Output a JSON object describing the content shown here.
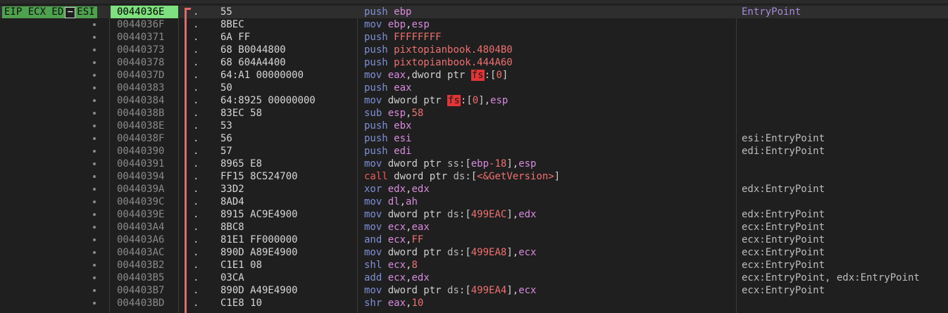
{
  "registers_label": {
    "prefix": "EIP ECX ED",
    "boxed": "−",
    "suffix": "ESI"
  },
  "rows": [
    {
      "addr": "0044036E",
      "marker": ".",
      "bytes": "55",
      "mnemonic": "push",
      "operands": [
        {
          "t": "ebp",
          "k": "reg"
        }
      ],
      "comment": "EntryPoint",
      "selected": true
    },
    {
      "addr": "0044036F",
      "marker": ".",
      "bytes": "8BEC",
      "mnemonic": "mov",
      "operands": [
        {
          "t": "ebp",
          "k": "reg"
        },
        {
          "t": ",",
          "k": "op"
        },
        {
          "t": "esp",
          "k": "reg"
        }
      ],
      "comment": ""
    },
    {
      "addr": "00440371",
      "marker": ".",
      "bytes": "6A FF",
      "mnemonic": "push",
      "operands": [
        {
          "t": "FFFFFFFF",
          "k": "num"
        }
      ],
      "comment": ""
    },
    {
      "addr": "00440373",
      "marker": ".",
      "bytes": "68 B0044800",
      "mnemonic": "push",
      "operands": [
        {
          "t": "pixtopianbook.4804B0",
          "k": "sym"
        }
      ],
      "comment": ""
    },
    {
      "addr": "00440378",
      "marker": ".",
      "bytes": "68 604A4400",
      "mnemonic": "push",
      "operands": [
        {
          "t": "pixtopianbook.444A60",
          "k": "sym"
        }
      ],
      "comment": ""
    },
    {
      "addr": "0044037D",
      "marker": ".",
      "bytes": "64:A1 00000000",
      "mnemonic": "mov",
      "operands": [
        {
          "t": "eax",
          "k": "reg"
        },
        {
          "t": ",dword ptr ",
          "k": "op"
        },
        {
          "t": "fs",
          "k": "segfs"
        },
        {
          "t": ":[",
          "k": "op"
        },
        {
          "t": "0",
          "k": "num"
        },
        {
          "t": "]",
          "k": "op"
        }
      ],
      "comment": ""
    },
    {
      "addr": "00440383",
      "marker": ".",
      "bytes": "50",
      "mnemonic": "push",
      "operands": [
        {
          "t": "eax",
          "k": "reg"
        }
      ],
      "comment": ""
    },
    {
      "addr": "00440384",
      "marker": ".",
      "bytes": "64:8925 00000000",
      "mnemonic": "mov",
      "operands": [
        {
          "t": "dword ptr ",
          "k": "op"
        },
        {
          "t": "fs",
          "k": "segfs"
        },
        {
          "t": ":[",
          "k": "op"
        },
        {
          "t": "0",
          "k": "num"
        },
        {
          "t": "],",
          "k": "op"
        },
        {
          "t": "esp",
          "k": "reg"
        }
      ],
      "comment": ""
    },
    {
      "addr": "0044038B",
      "marker": ".",
      "bytes": "83EC 58",
      "mnemonic": "sub",
      "operands": [
        {
          "t": "esp",
          "k": "reg"
        },
        {
          "t": ",",
          "k": "op"
        },
        {
          "t": "58",
          "k": "num"
        }
      ],
      "comment": ""
    },
    {
      "addr": "0044038E",
      "marker": ".",
      "bytes": "53",
      "mnemonic": "push",
      "operands": [
        {
          "t": "ebx",
          "k": "reg"
        }
      ],
      "comment": ""
    },
    {
      "addr": "0044038F",
      "marker": ".",
      "bytes": "56",
      "mnemonic": "push",
      "operands": [
        {
          "t": "esi",
          "k": "reg"
        }
      ],
      "comment": "esi:EntryPoint"
    },
    {
      "addr": "00440390",
      "marker": ".",
      "bytes": "57",
      "mnemonic": "push",
      "operands": [
        {
          "t": "edi",
          "k": "reg"
        }
      ],
      "comment": "edi:EntryPoint"
    },
    {
      "addr": "00440391",
      "marker": ".",
      "bytes": "8965 E8",
      "mnemonic": "mov",
      "operands": [
        {
          "t": "dword ptr ",
          "k": "op"
        },
        {
          "t": "ss",
          "k": "seg"
        },
        {
          "t": ":[",
          "k": "op"
        },
        {
          "t": "ebp",
          "k": "reg"
        },
        {
          "t": "-18",
          "k": "num"
        },
        {
          "t": "],",
          "k": "op"
        },
        {
          "t": "esp",
          "k": "reg"
        }
      ],
      "comment": ""
    },
    {
      "addr": "00440394",
      "marker": ".",
      "bytes": "FF15 8C524700",
      "mnemonic": "call",
      "mnemonic_kind": "call",
      "operands": [
        {
          "t": "dword ptr ",
          "k": "op"
        },
        {
          "t": "ds",
          "k": "seg"
        },
        {
          "t": ":[",
          "k": "op"
        },
        {
          "t": "<&GetVersion>",
          "k": "sym"
        },
        {
          "t": "]",
          "k": "op"
        }
      ],
      "comment": ""
    },
    {
      "addr": "0044039A",
      "marker": ".",
      "bytes": "33D2",
      "mnemonic": "xor",
      "operands": [
        {
          "t": "edx",
          "k": "reg"
        },
        {
          "t": ",",
          "k": "op"
        },
        {
          "t": "edx",
          "k": "reg"
        }
      ],
      "comment": "edx:EntryPoint"
    },
    {
      "addr": "0044039C",
      "marker": ".",
      "bytes": "8AD4",
      "mnemonic": "mov",
      "operands": [
        {
          "t": "dl",
          "k": "reg"
        },
        {
          "t": ",",
          "k": "op"
        },
        {
          "t": "ah",
          "k": "reg"
        }
      ],
      "comment": ""
    },
    {
      "addr": "0044039E",
      "marker": ".",
      "bytes": "8915 AC9E4900",
      "mnemonic": "mov",
      "operands": [
        {
          "t": "dword ptr ",
          "k": "op"
        },
        {
          "t": "ds",
          "k": "seg"
        },
        {
          "t": ":[",
          "k": "op"
        },
        {
          "t": "499EAC",
          "k": "num"
        },
        {
          "t": "],",
          "k": "op"
        },
        {
          "t": "edx",
          "k": "reg"
        }
      ],
      "comment": "edx:EntryPoint"
    },
    {
      "addr": "004403A4",
      "marker": ".",
      "bytes": "8BC8",
      "mnemonic": "mov",
      "operands": [
        {
          "t": "ecx",
          "k": "reg"
        },
        {
          "t": ",",
          "k": "op"
        },
        {
          "t": "eax",
          "k": "reg"
        }
      ],
      "comment": "ecx:EntryPoint"
    },
    {
      "addr": "004403A6",
      "marker": ".",
      "bytes": "81E1 FF000000",
      "mnemonic": "and",
      "operands": [
        {
          "t": "ecx",
          "k": "reg"
        },
        {
          "t": ",",
          "k": "op"
        },
        {
          "t": "FF",
          "k": "num"
        }
      ],
      "comment": "ecx:EntryPoint"
    },
    {
      "addr": "004403AC",
      "marker": ".",
      "bytes": "890D A89E4900",
      "mnemonic": "mov",
      "operands": [
        {
          "t": "dword ptr ",
          "k": "op"
        },
        {
          "t": "ds",
          "k": "seg"
        },
        {
          "t": ":[",
          "k": "op"
        },
        {
          "t": "499EA8",
          "k": "num"
        },
        {
          "t": "],",
          "k": "op"
        },
        {
          "t": "ecx",
          "k": "reg"
        }
      ],
      "comment": "ecx:EntryPoint"
    },
    {
      "addr": "004403B2",
      "marker": ".",
      "bytes": "C1E1 08",
      "mnemonic": "shl",
      "operands": [
        {
          "t": "ecx",
          "k": "reg"
        },
        {
          "t": ",",
          "k": "op"
        },
        {
          "t": "8",
          "k": "num"
        }
      ],
      "comment": "ecx:EntryPoint"
    },
    {
      "addr": "004403B5",
      "marker": ".",
      "bytes": "03CA",
      "mnemonic": "add",
      "operands": [
        {
          "t": "ecx",
          "k": "reg"
        },
        {
          "t": ",",
          "k": "op"
        },
        {
          "t": "edx",
          "k": "reg"
        }
      ],
      "comment": "ecx:EntryPoint, edx:EntryPoint"
    },
    {
      "addr": "004403B7",
      "marker": ".",
      "bytes": "890D A49E4900",
      "mnemonic": "mov",
      "operands": [
        {
          "t": "dword ptr ",
          "k": "op"
        },
        {
          "t": "ds",
          "k": "seg"
        },
        {
          "t": ":[",
          "k": "op"
        },
        {
          "t": "499EA4",
          "k": "num"
        },
        {
          "t": "],",
          "k": "op"
        },
        {
          "t": "ecx",
          "k": "reg"
        }
      ],
      "comment": "ecx:EntryPoint"
    },
    {
      "addr": "004403BD",
      "marker": ".",
      "bytes": "C1E8 10",
      "mnemonic": "shr",
      "operands": [
        {
          "t": "eax",
          "k": "reg"
        },
        {
          "t": ",",
          "k": "op"
        },
        {
          "t": "10",
          "k": "num"
        }
      ],
      "comment": ""
    }
  ],
  "colors": {
    "selected_address_bg": "#7ee07e",
    "register_label_bg": "#4ea14e",
    "jump_line": "#e06a6a",
    "fs_highlight": "#e23535"
  }
}
